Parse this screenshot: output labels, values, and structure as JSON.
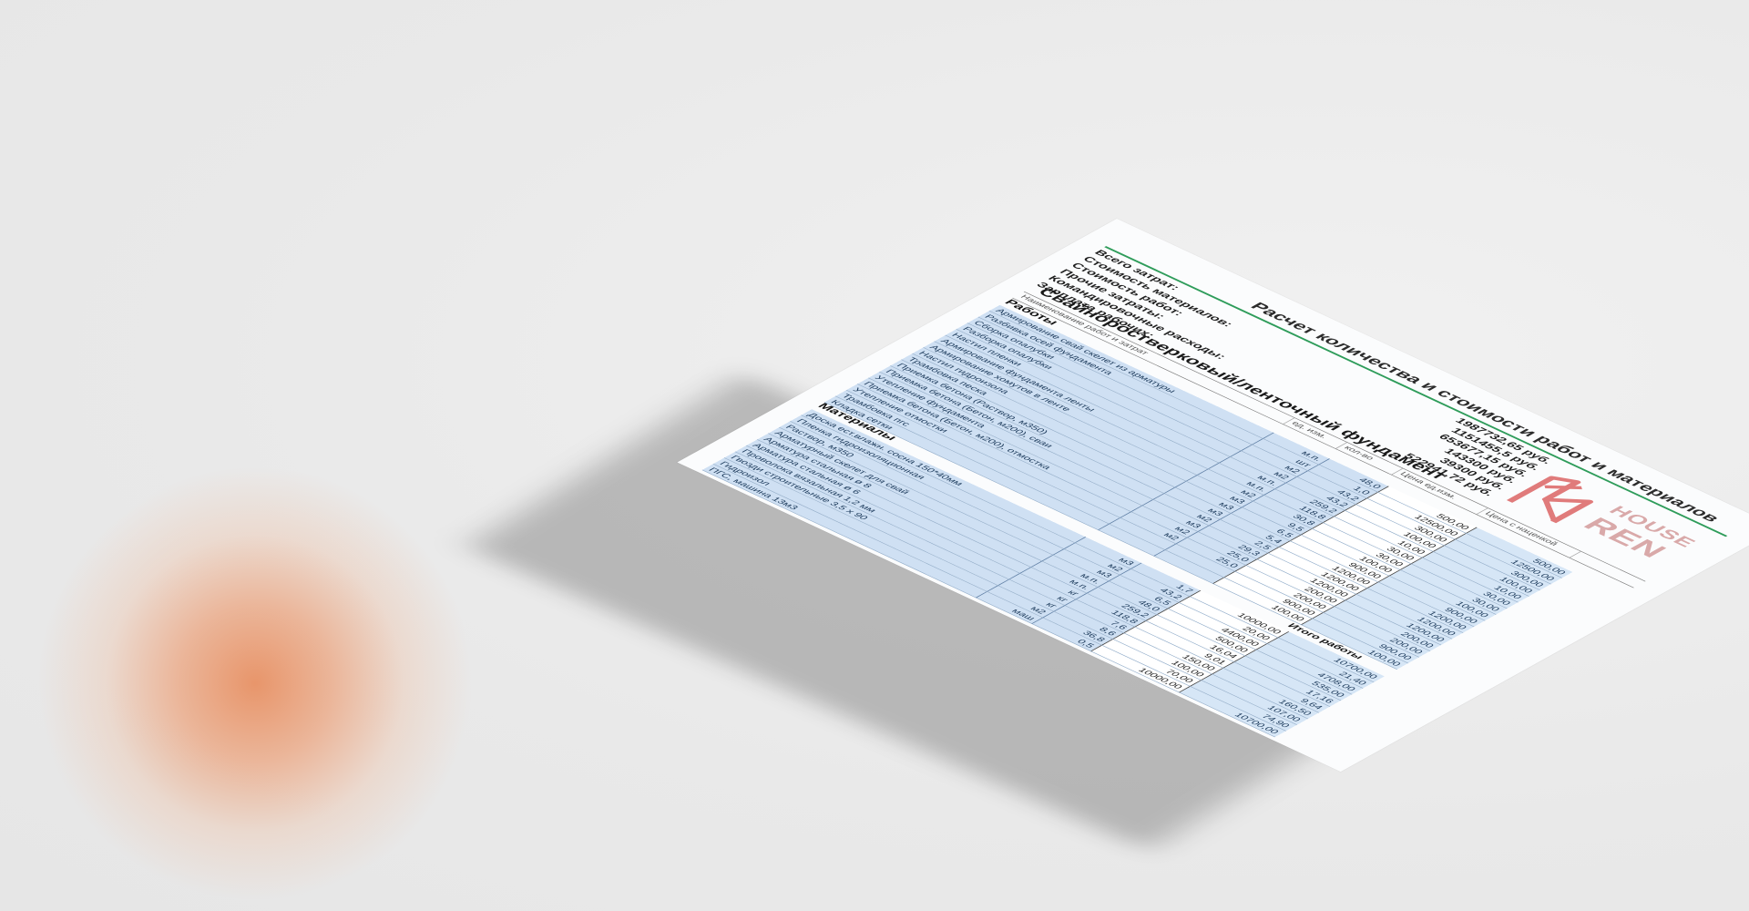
{
  "document": {
    "title": "Расчет количества и стоимости работ и материалов",
    "summary": [
      {
        "label": "Всего затрат:",
        "value": "1987732,65 руб."
      },
      {
        "label": "Стоимость материалов:",
        "value": "1151455,5 руб."
      },
      {
        "label": "Стоимость работ:",
        "value": "653677,15 руб."
      },
      {
        "label": "Прочие затраты:",
        "value": "143300 руб."
      },
      {
        "label": "Командировочные расходы:",
        "value": "39300 руб."
      },
      {
        "label": "Зарплата рабочих:",
        "value": "522941,72 руб."
      }
    ],
    "section_title": "Свайноростверковый/ленточный фундамент",
    "columns": [
      "Наименование работ и затрат",
      "ед. изм.",
      "кол-во",
      "Цена ед.изм.",
      "Цена с наценкой"
    ],
    "works_title": "Работы",
    "works": [
      {
        "name": "Армирование свай скелет из арматуры",
        "unit": "м.п.",
        "qty": "48,0",
        "price": "500,00",
        "total": "500,00"
      },
      {
        "name": "Разбивка осей фундамента",
        "unit": "шт",
        "qty": "1,0",
        "price": "12500,00",
        "total": "12500,00"
      },
      {
        "name": "Сборка опалубки",
        "unit": "м2",
        "qty": "43,2",
        "price": "300,00",
        "total": "300,00"
      },
      {
        "name": "Разборка опалубки",
        "unit": "м2",
        "qty": "43,2",
        "price": "100,00",
        "total": "100,00"
      },
      {
        "name": "Настил пленки",
        "unit": "м.п.",
        "qty": "259,2",
        "price": "10,00",
        "total": "10,00"
      },
      {
        "name": "Армирование фундамента ленты",
        "unit": "м.п.",
        "qty": "118,8",
        "price": "30,00",
        "total": "30,00"
      },
      {
        "name": "Армирование хомутов в ленте",
        "unit": "м2",
        "qty": "30,8",
        "price": "30,00",
        "total": "30,00"
      },
      {
        "name": "Настил гидроизола",
        "unit": "м3",
        "qty": "9,5",
        "price": "100,00",
        "total": "100,00"
      },
      {
        "name": "Трамбовка песка",
        "unit": "м3",
        "qty": "6,5",
        "price": "900,00",
        "total": "900,00"
      },
      {
        "name": "Приемка бетона (Раствор, м350)",
        "unit": "м3",
        "qty": "5,4",
        "price": "1200,00",
        "total": "1200,00"
      },
      {
        "name": "Приемка бетона (Бетон, м200), сваи",
        "unit": "м2",
        "qty": "2,5",
        "price": "1200,00",
        "total": "1200,00"
      },
      {
        "name": "Утепление фундамента",
        "unit": "м3",
        "qty": "29,3",
        "price": "1200,00",
        "total": "1200,00"
      },
      {
        "name": "Приемка бетона (Бетон, м200), отмостка",
        "unit": "м2",
        "qty": "25,0",
        "price": "200,00",
        "total": "200,00"
      },
      {
        "name": "Утепление отмостки",
        "unit": "м2",
        "qty": "25,0",
        "price": "200,00",
        "total": "200,00"
      },
      {
        "name": "Трамбовка пгс",
        "unit": "",
        "qty": "",
        "price": "900,00",
        "total": "900,00"
      },
      {
        "name": "Кладка сетки",
        "unit": "",
        "qty": "",
        "price": "100,00",
        "total": "100,00"
      }
    ],
    "works_total_label": "Итого работы",
    "materials_title": "Материалы",
    "materials": [
      {
        "name": "Доска ест.влажн. сосна 150*40мм",
        "unit": "м3",
        "qty": "1,7",
        "price": "10000,00",
        "total": "10700,00"
      },
      {
        "name": "Пленка гидроизоляционная",
        "unit": "м2",
        "qty": "43,2",
        "price": "20,00",
        "total": "21,40"
      },
      {
        "name": "Раствор, м350",
        "unit": "м3",
        "qty": "6,5",
        "price": "4400,00",
        "total": "4708,00"
      },
      {
        "name": "Арматурный скелет для свай",
        "unit": "м.п.",
        "qty": "48,0",
        "price": "500,00",
        "total": "535,00"
      },
      {
        "name": "Арматура стальная ø 8",
        "unit": "м.п.",
        "qty": "259,2",
        "price": "16,04",
        "total": "17,16"
      },
      {
        "name": "Арматура стальная ø 6",
        "unit": "кг",
        "qty": "118,8",
        "price": "9,01",
        "total": "9,64"
      },
      {
        "name": "Проволока вязальная 1,2 мм",
        "unit": "кг",
        "qty": "7,6",
        "price": "150,00",
        "total": "160,50"
      },
      {
        "name": "Гвозди строительные 3,5 х 90",
        "unit": "кг",
        "qty": "8,6",
        "price": "100,00",
        "total": "107,00"
      },
      {
        "name": "Гидроизол",
        "unit": "м2",
        "qty": "36,8",
        "price": "70,00",
        "total": "74,90"
      },
      {
        "name": "ПГС, машина 13м3",
        "unit": "маш",
        "qty": "0,5",
        "price": "10000,00",
        "total": "10700,00"
      }
    ],
    "logo": {
      "line1": "HOUSE",
      "line2": "REN",
      "color": "#e07b7b"
    }
  },
  "colors": {
    "accent_green": "#2e9c5a",
    "cell_blue": "#cfe0f3",
    "background": "#ebebeb",
    "blob": "#e8916a"
  }
}
